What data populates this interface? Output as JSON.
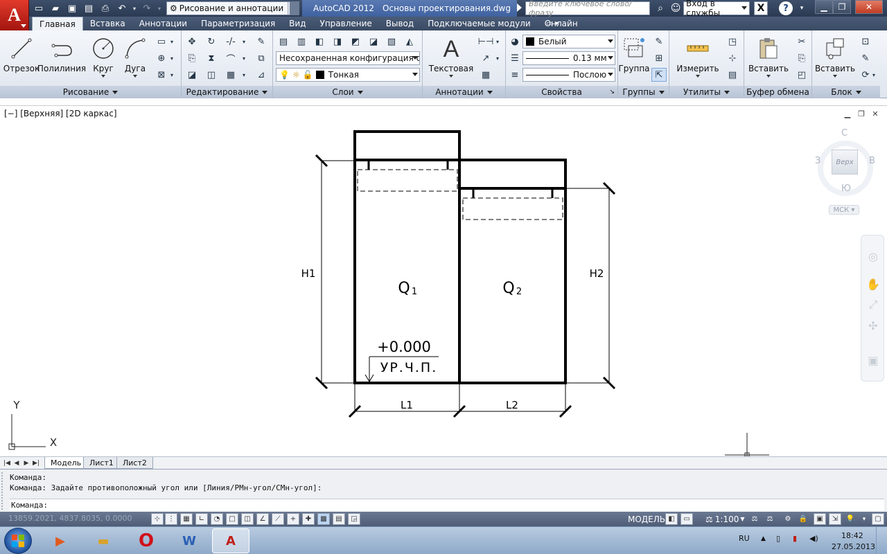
{
  "title_bar": {
    "workspace": "Рисование и аннотации",
    "app_name": "AutoCAD 2012",
    "file_name": "Основы проектирования.dwg",
    "search_placeholder": "Введите ключевое слово/фразу",
    "login": "Вход в службы",
    "app_logo": "A"
  },
  "ribbon_tabs": [
    "Главная",
    "Вставка",
    "Аннотации",
    "Параметризация",
    "Вид",
    "Управление",
    "Вывод",
    "Подключаемые модули",
    "Онлайн"
  ],
  "ribbon": {
    "draw": {
      "title": "Рисование",
      "line": "Отрезок",
      "polyline": "Полилиния",
      "circle": "Круг",
      "arc": "Дуга"
    },
    "modify": {
      "title": "Редактирование"
    },
    "layers": {
      "title": "Слои",
      "layer_state": "Несохраненная конфигурация сло",
      "current_layer": "Тонкая"
    },
    "annotation": {
      "title": "Аннотации",
      "text": "Текстовая"
    },
    "properties": {
      "title": "Свойства",
      "color": "Белый",
      "lineweight": "0.13 мм",
      "linetype": "Послою"
    },
    "groups": {
      "title": "Группы",
      "group": "Группа"
    },
    "utilities": {
      "title": "Утилиты",
      "measure": "Измерить"
    },
    "clipboard": {
      "title": "Буфер обмена",
      "paste": "Вставить"
    },
    "block": {
      "title": "Блок",
      "insert": "Вставить"
    }
  },
  "viewport": {
    "label": "[−] [Верхняя] [2D каркас]",
    "drawing": {
      "h1": "H1",
      "h2": "H2",
      "l1": "L1",
      "l2": "L2",
      "q1": "Q",
      "q1_sub": "1",
      "q2": "Q",
      "q2_sub": "2",
      "level_value": "+0.000",
      "level_label": "УР.Ч.П."
    },
    "ucs": {
      "y": "Y",
      "x": "X"
    },
    "viewcube": {
      "north": "С",
      "south": "Ю",
      "west": "З",
      "east": "В",
      "face": "Верх",
      "wcs": "МСК"
    }
  },
  "layout_tabs": [
    "Модель",
    "Лист1",
    "Лист2"
  ],
  "command_line": {
    "history": [
      "Команда:",
      "Команда: Задайте противоположный угол или [Линия/РМн-угол/СМн-угол]:"
    ],
    "prompt": "Команда:"
  },
  "status_bar": {
    "coords": "13859.2021, 4837.8035, 0.0000",
    "model": "МОДЕЛЬ",
    "scale": "1:100"
  },
  "taskbar": {
    "language": "RU",
    "time": "18:42",
    "date": "27.05.2013"
  }
}
